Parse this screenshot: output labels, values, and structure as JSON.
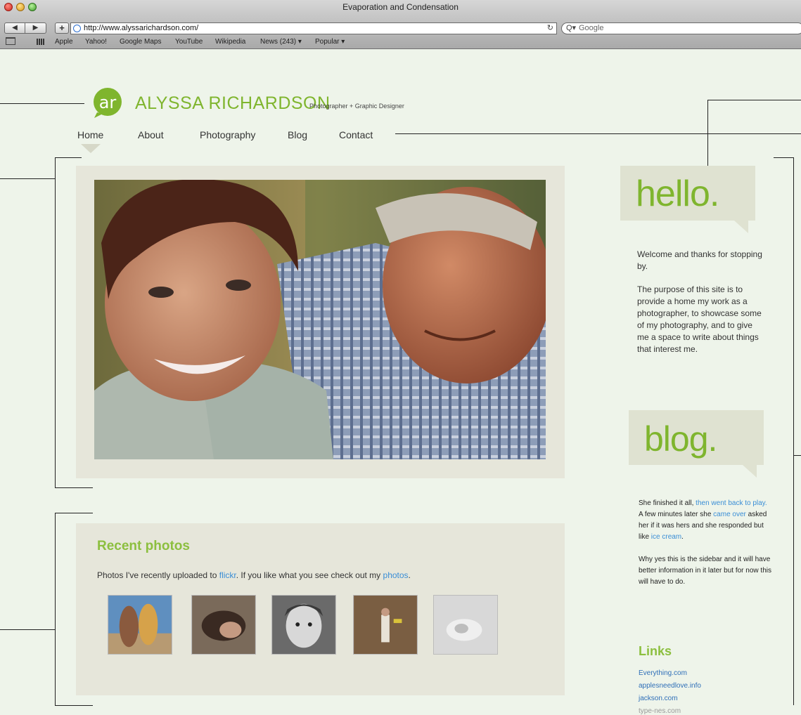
{
  "browser": {
    "window_title": "Evaporation and Condensation",
    "back_glyph": "◀",
    "forward_glyph": "▶",
    "add_glyph": "+",
    "url": "http://www.alyssarichardson.com/",
    "reload_glyph": "↻",
    "search_placeholder": "Google",
    "search_glyph": "Q▾",
    "bookmarks": [
      "Apple",
      "Yahoo!",
      "Google Maps",
      "YouTube",
      "Wikipedia",
      "News (243) ▾",
      "Popular ▾"
    ]
  },
  "site": {
    "logo_letters": "ar",
    "name": "ALYSSA RICHARDSON",
    "tagline": "Photographer + Graphic Designer",
    "nav": [
      "Home",
      "About",
      "Photography",
      "Blog",
      "Contact"
    ],
    "active_nav": "Home"
  },
  "recent": {
    "title": "Recent photos",
    "desc_prefix": "Photos I've recently uploaded to ",
    "desc_link1": "flickr",
    "desc_middle": ". If you like what you see check out my ",
    "desc_link2": "photos",
    "desc_suffix": "."
  },
  "sidebar": {
    "hello_heading": "hello.",
    "hello_p1": "Welcome and thanks for stopping by.",
    "hello_p2": "The purpose of this site is to provide a home my work as a photographer, to showcase some of my photography, and to give me a space to write about things that interest me.",
    "blog_heading": "blog.",
    "blog_a1": "She finished it all, ",
    "blog_a_link1": "then went back to play.",
    "blog_a2": " A few minutes later she ",
    "blog_a_link2": "came over",
    "blog_a3": " asked her if it was hers and she responded but like ",
    "blog_a_link3": "ice cream",
    "blog_a4": ".",
    "blog_p2": "Why yes this is the sidebar and it will have better information in it later but for now this will have to do.",
    "links_heading": "Links",
    "links": [
      "Everything.com",
      "applesneedlove.info",
      "jackson.com",
      "type-nes.com"
    ]
  },
  "colors": {
    "page_bg": "#eef4ea",
    "accent_green": "#7fb52e",
    "box_bg": "#e6e6da",
    "link_blue": "#3a8ed6"
  }
}
